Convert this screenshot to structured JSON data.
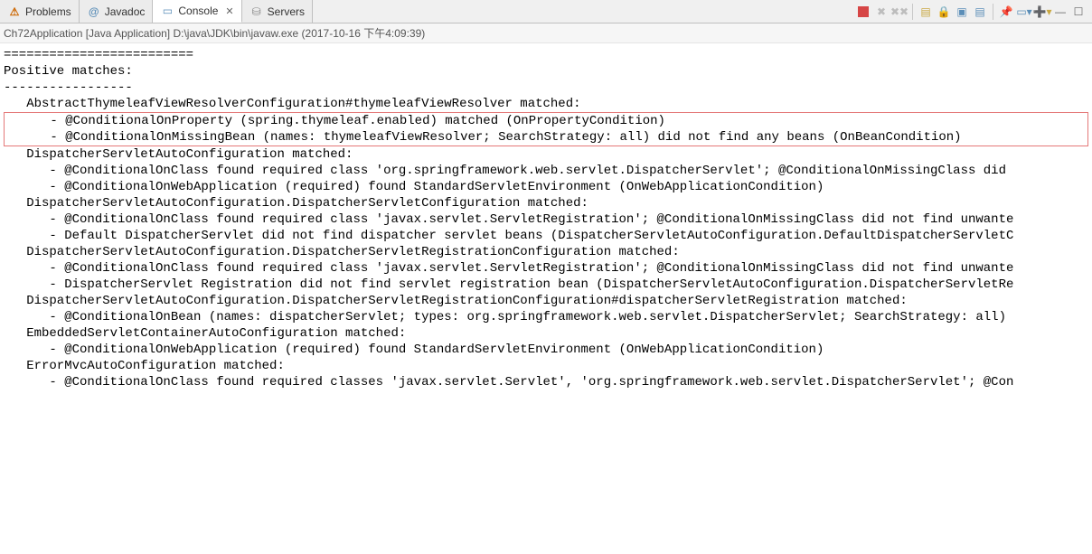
{
  "tabs": [
    {
      "label": "Problems",
      "iconClass": "ic-warn",
      "iconGlyph": "⚠"
    },
    {
      "label": "Javadoc",
      "iconClass": "ic-at",
      "iconGlyph": "@"
    },
    {
      "label": "Console",
      "iconClass": "ic-console",
      "iconGlyph": "▭",
      "active": true,
      "closeable": true
    },
    {
      "label": "Servers",
      "iconClass": "ic-server",
      "iconGlyph": "⛁"
    }
  ],
  "statusLine": "Ch72Application [Java Application] D:\\java\\JDK\\bin\\javaw.exe (2017-10-16 下午4:09:39)",
  "console": {
    "lines": [
      "=========================",
      "",
      "",
      "Positive matches:",
      "-----------------",
      "",
      "   AbstractThymeleafViewResolverConfiguration#thymeleafViewResolver matched:",
      "      - @ConditionalOnProperty (spring.thymeleaf.enabled) matched (OnPropertyCondition)",
      "      - @ConditionalOnMissingBean (names: thymeleafViewResolver; SearchStrategy: all) did not find any beans (OnBeanCondition)",
      "",
      "   DispatcherServletAutoConfiguration matched:",
      "      - @ConditionalOnClass found required class 'org.springframework.web.servlet.DispatcherServlet'; @ConditionalOnMissingClass did ",
      "      - @ConditionalOnWebApplication (required) found StandardServletEnvironment (OnWebApplicationCondition)",
      "",
      "   DispatcherServletAutoConfiguration.DispatcherServletConfiguration matched:",
      "      - @ConditionalOnClass found required class 'javax.servlet.ServletRegistration'; @ConditionalOnMissingClass did not find unwante",
      "      - Default DispatcherServlet did not find dispatcher servlet beans (DispatcherServletAutoConfiguration.DefaultDispatcherServletC",
      "",
      "   DispatcherServletAutoConfiguration.DispatcherServletRegistrationConfiguration matched:",
      "      - @ConditionalOnClass found required class 'javax.servlet.ServletRegistration'; @ConditionalOnMissingClass did not find unwante",
      "      - DispatcherServlet Registration did not find servlet registration bean (DispatcherServletAutoConfiguration.DispatcherServletRe",
      "",
      "   DispatcherServletAutoConfiguration.DispatcherServletRegistrationConfiguration#dispatcherServletRegistration matched:",
      "      - @ConditionalOnBean (names: dispatcherServlet; types: org.springframework.web.servlet.DispatcherServlet; SearchStrategy: all) ",
      "",
      "   EmbeddedServletContainerAutoConfiguration matched:",
      "      - @ConditionalOnWebApplication (required) found StandardServletEnvironment (OnWebApplicationCondition)",
      "",
      "   ErrorMvcAutoConfiguration matched:",
      "      - @ConditionalOnClass found required classes 'javax.servlet.Servlet', 'org.springframework.web.servlet.DispatcherServlet'; @Con"
    ],
    "highlightRange": [
      7,
      9
    ]
  }
}
